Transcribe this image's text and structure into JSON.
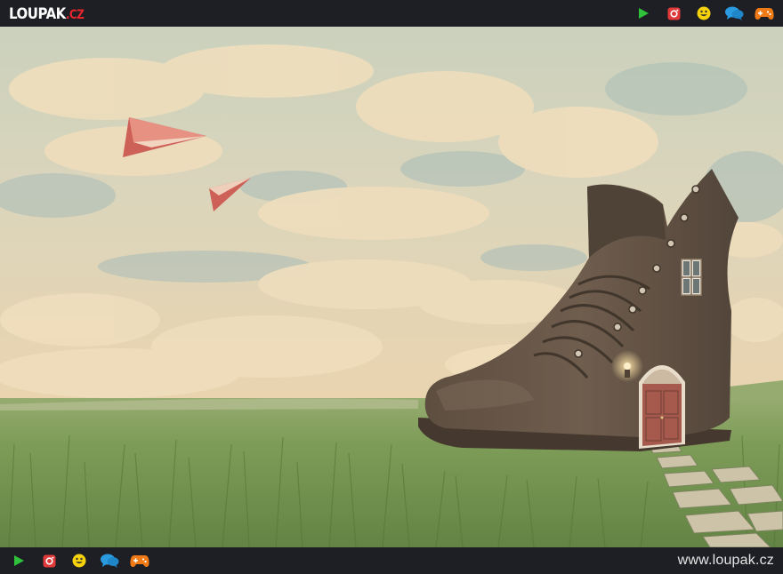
{
  "header": {
    "logo": {
      "main": "LOUPAK",
      "accent": ".CZ"
    },
    "icons": [
      "play-icon",
      "instagram-icon",
      "smiley-icon",
      "chat-icon",
      "gamepad-icon"
    ]
  },
  "footer": {
    "icons": [
      "play-icon",
      "instagram-icon",
      "smiley-icon",
      "chat-icon",
      "gamepad-icon"
    ],
    "site_url": "www.loupak.cz"
  },
  "colors": {
    "play": "#2fc13a",
    "instagram": "#e03a3a",
    "smiley": "#f5d20a",
    "chat": "#2a9be0",
    "gamepad": "#f07a16",
    "bar_background": "#1d1f25"
  },
  "scene": {
    "subject": "giant old boot turned into a house with a door and window on a grass field under a cloudy sky with paper planes"
  }
}
